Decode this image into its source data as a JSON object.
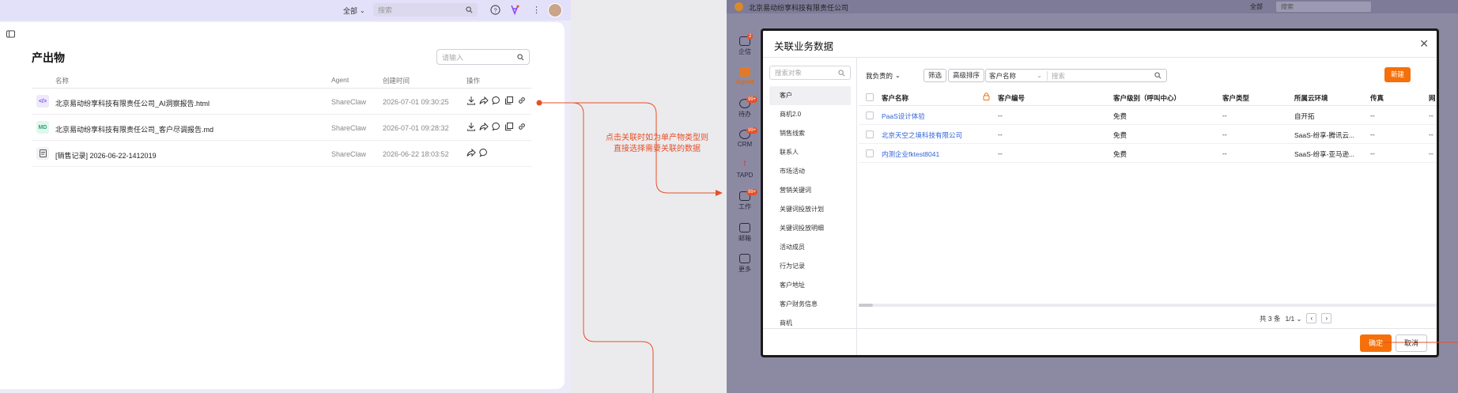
{
  "left": {
    "scope_label": "全部",
    "search_placeholder": "搜索",
    "title": "产出物",
    "filter_placeholder": "请输入",
    "columns": [
      "名称",
      "Agent",
      "创建时间",
      "操作"
    ],
    "rows": [
      {
        "icon_text": "</>",
        "name": "北京易动纷享科技有限责任公司_AI洞察报告.html",
        "agent": "ShareClaw",
        "time": "2026-07-01 09:30:25"
      },
      {
        "icon_text": "MD",
        "name": "北京易动纷享科技有限责任公司_客户尽调报告.md",
        "agent": "ShareClaw",
        "time": "2026-07-01 09:28:32"
      },
      {
        "icon_text": "",
        "name": "[销售记录] 2026-06-22-1412019",
        "agent": "ShareClaw",
        "time": "2026-06-22 18:03:52"
      }
    ]
  },
  "annotation": {
    "line1": "点击关联时如为单产物类型则",
    "line2": "直接选择需要关联的数据",
    "color": "#e65027"
  },
  "right": {
    "company": "北京易动纷享科技有限责任公司",
    "scope_label": "全部",
    "search_placeholder": "搜索",
    "nav": [
      {
        "label": "企信",
        "badge": "2"
      },
      {
        "label": "Agent",
        "badge": ""
      },
      {
        "label": "待办",
        "badge": "99+"
      },
      {
        "label": "CRM",
        "badge": "99+"
      },
      {
        "label": "TAPD",
        "badge": ""
      },
      {
        "label": "工作",
        "badge": "99+"
      },
      {
        "label": "邮箱",
        "badge": ""
      },
      {
        "label": "更多",
        "badge": ""
      }
    ]
  },
  "dialog": {
    "title": "关联业务数据",
    "object_search_placeholder": "搜索对象",
    "objects": [
      "客户",
      "商机2.0",
      "销售线索",
      "联系人",
      "市场活动",
      "营销关键词",
      "关键词投放计划",
      "关键词投放明细",
      "活动成员",
      "行为记录",
      "客户地址",
      "客户财务信息",
      "商机"
    ],
    "active_object": "客户",
    "owner_filter": "我负责的",
    "filter_btn": "筛选",
    "sort_btn": "高级排序",
    "field_select": "客户名称",
    "query_placeholder": "搜索",
    "new_btn": "新建",
    "columns": [
      "客户名称",
      "客户编号",
      "客户级别（呼叫中心）",
      "客户类型",
      "所属云环境",
      "传真",
      "网"
    ],
    "rows": [
      {
        "name": "PaaS设计体验",
        "code": "--",
        "level": "免费",
        "type": "--",
        "cloud": "自开拓",
        "fax": "--",
        "web": "--"
      },
      {
        "name": "北京天空之境科技有限公司",
        "code": "--",
        "level": "免费",
        "type": "--",
        "cloud": "SaaS-纷享-腾讯云...",
        "fax": "--",
        "web": "--"
      },
      {
        "name": "内测企业fktest8041",
        "code": "--",
        "level": "免费",
        "type": "--",
        "cloud": "SaaS-纷享-亚马逊...",
        "fax": "--",
        "web": "--"
      }
    ],
    "total": "共 3 条",
    "page": "1/1",
    "ok_btn": "确定",
    "cancel_btn": "取消"
  }
}
